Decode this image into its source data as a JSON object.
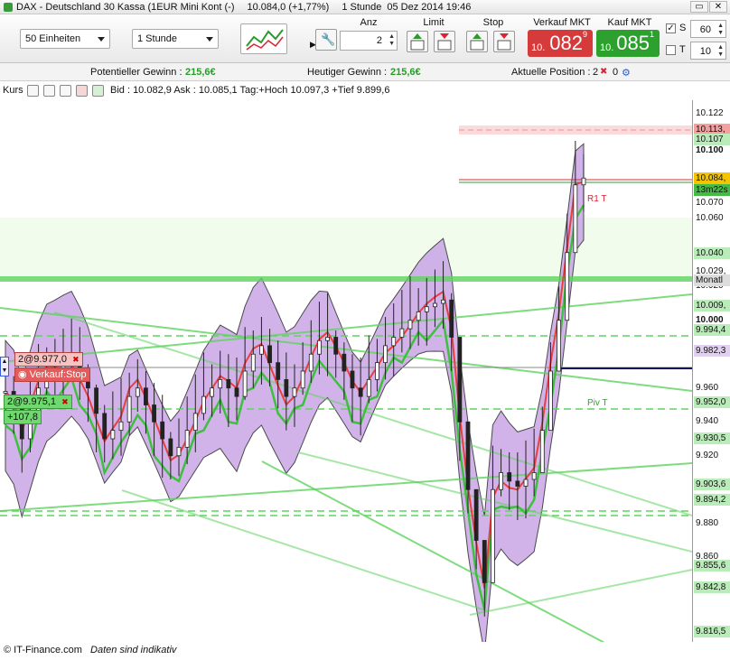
{
  "window": {
    "title": "DAX - Deutschland 30 Kassa (1EUR Mini Kont (-)",
    "quote_text": "10.084,0 (+1,77%)",
    "period": "1 Stunde",
    "timestamp": "05 Dez 2014 19:46"
  },
  "toolbar": {
    "units_value": "50 Einheiten",
    "interval_value": "1 Stunde",
    "anz_label": "Anz",
    "anz_value": "2",
    "limit_label": "Limit",
    "stop_label": "Stop",
    "sell_label": "Verkauf MKT",
    "buy_label": "Kauf MKT",
    "sell_price_prefix": "10.",
    "sell_price_main": "082",
    "sell_price_sup": "9",
    "buy_price_prefix": "10.",
    "buy_price_main": "085",
    "buy_price_sup": "1",
    "s_label": "S",
    "s_value": "60",
    "t_label": "T",
    "t_value": "10",
    "s_checked": "✓"
  },
  "info": {
    "potential_label": "Potentieller Gewinn :",
    "potential_value": "215,6€",
    "today_label": "Heutiger Gewinn :",
    "today_value": "215,6€",
    "position_label": "Aktuelle Position :",
    "position_value_a": "2",
    "position_value_b": "0"
  },
  "chart_header": {
    "label": "Kurs",
    "quote": "Bid : 10.082,9 Ask : 10.085,1 Tag:+Hoch 10.097,3 +Tief 9.899,6"
  },
  "orders": {
    "order1": "2@9.977,0",
    "order1_type": "Verkauf:Stop",
    "order2": "2@9.975,1",
    "order2_pl": "+107,8"
  },
  "chart_data": {
    "type": "candlestick",
    "ylim": [
      9810,
      10130
    ],
    "y_ticks": [
      "10.122",
      "10.100",
      "10.060",
      "10.040",
      "10.020",
      "10.000",
      "9.960",
      "9.940",
      "9.920",
      "9.880",
      "9.860"
    ],
    "price_tags": [
      {
        "text": "10.113,",
        "value": 10113,
        "bg": "#f2a0a0"
      },
      {
        "text": "10.107",
        "value": 10107,
        "bg": "#b9ecb9"
      },
      {
        "text": "10.084,",
        "value": 10084,
        "bg": "#f5c400"
      },
      {
        "text": "13m22s",
        "value": 10077,
        "bg": "#44bb44"
      },
      {
        "text": "10.070",
        "value": 10070,
        "bg": "#ffffff"
      },
      {
        "text": "10.040",
        "value": 10040,
        "bg": "#b9ecb9"
      },
      {
        "text": "10.029,",
        "value": 10029,
        "bg": "#ffffff"
      },
      {
        "text": "Monatl",
        "value": 10024,
        "bg": "#dddddd"
      },
      {
        "text": "10.009,",
        "value": 10009,
        "bg": "#b9ecb9"
      },
      {
        "text": "9.994,4",
        "value": 9994.4,
        "bg": "#b9ecb9"
      },
      {
        "text": "9.982,3",
        "value": 9982.3,
        "bg": "#e1d0ef"
      },
      {
        "text": "9.952,0",
        "value": 9952,
        "bg": "#b9ecb9"
      },
      {
        "text": "9.930,5",
        "value": 9930.5,
        "bg": "#b9ecb9"
      },
      {
        "text": "9.903,6",
        "value": 9903.6,
        "bg": "#b9ecb9"
      },
      {
        "text": "9.894,2",
        "value": 9894.2,
        "bg": "#b9ecb9"
      },
      {
        "text": "9.855,6",
        "value": 9855.6,
        "bg": "#b9ecb9"
      },
      {
        "text": "9.842,8",
        "value": 9842.8,
        "bg": "#b9ecb9"
      },
      {
        "text": "9.816,5",
        "value": 9816.5,
        "bg": "#b9ecb9"
      }
    ],
    "annotations": [
      "R1 T",
      "Piv T"
    ],
    "close_series": [
      9958,
      9950,
      9930,
      9945,
      9960,
      9970,
      9972,
      9975,
      9978,
      9970,
      9960,
      9945,
      9930,
      9935,
      9940,
      9955,
      9960,
      9950,
      9940,
      9930,
      9920,
      9925,
      9935,
      9945,
      9955,
      9960,
      9965,
      9960,
      9955,
      9970,
      9980,
      9985,
      9975,
      9965,
      9955,
      9960,
      9970,
      9980,
      9988,
      9990,
      9980,
      9970,
      9960,
      9955,
      9965,
      9975,
      9985,
      9990,
      9995,
      10000,
      10005,
      10008,
      10010,
      10012,
      9990,
      9940,
      9900,
      9870,
      9845,
      9900,
      9910,
      9905,
      9902,
      9906,
      9910,
      9935,
      9970,
      10000,
      10040,
      10080,
      10084
    ],
    "colors": {
      "band_fill": "#c9a6e6",
      "band_stroke": "#2b2b2b",
      "trend_green": "#5fd35f",
      "ma_red": "#e84040",
      "candle": "#222222"
    }
  },
  "footer": {
    "copyright": "© IT-Finance.com",
    "note": "Daten sind indikativ"
  }
}
